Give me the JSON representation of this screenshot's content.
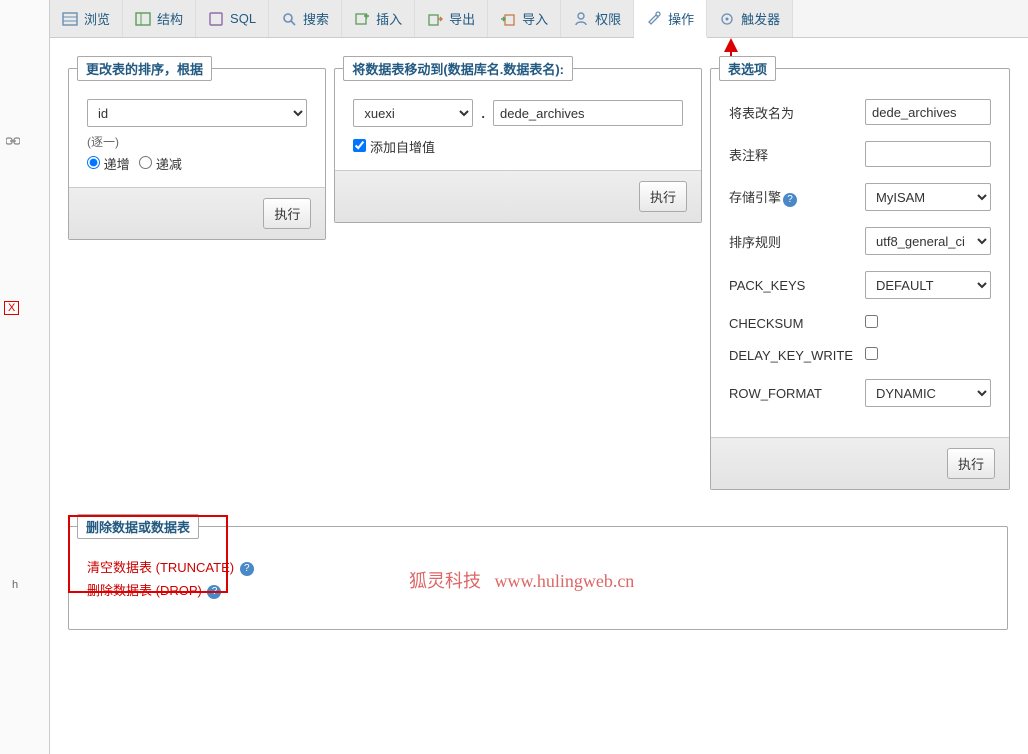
{
  "sidebar": {
    "badge": "X",
    "truncated": "h"
  },
  "nav": {
    "tabs": [
      {
        "label": "浏览",
        "icon_color": "#6b8fb5"
      },
      {
        "label": "结构",
        "icon_color": "#5a9e5a"
      },
      {
        "label": "SQL",
        "icon_color": "#8a6ca8"
      },
      {
        "label": "搜索",
        "icon_color": "#6b8fb5"
      },
      {
        "label": "插入",
        "icon_color": "#5a9e5a"
      },
      {
        "label": "导出",
        "icon_color": "#5a9e5a"
      },
      {
        "label": "导入",
        "icon_color": "#c77b4a"
      },
      {
        "label": "权限",
        "icon_color": "#6b8fb5"
      },
      {
        "label": "操作",
        "icon_color": "#6b8fb5"
      },
      {
        "label": "触发器",
        "icon_color": "#6b8fb5"
      }
    ],
    "active_index": 8
  },
  "panel_order": {
    "legend": "更改表的排序，根据",
    "column_select": "id",
    "hint": "(逐一)",
    "asc_label": "递增",
    "desc_label": "递减",
    "go_label": "执行"
  },
  "panel_move": {
    "legend": "将数据表移动到(数据库名.数据表名):",
    "db_select": "xuexi",
    "dot": ".",
    "table_input": "dede_archives",
    "add_auto_label": "添加自增值",
    "go_label": "执行"
  },
  "panel_options": {
    "legend": "表选项",
    "rows": {
      "rename": {
        "label": "将表改名为",
        "value": "dede_archives"
      },
      "comment": {
        "label": "表注释",
        "value": ""
      },
      "engine": {
        "label": "存储引擎",
        "value": "MyISAM"
      },
      "collation": {
        "label": "排序规则",
        "value": "utf8_general_ci"
      },
      "pack_keys": {
        "label": "PACK_KEYS",
        "value": "DEFAULT"
      },
      "checksum": {
        "label": "CHECKSUM"
      },
      "delay_key_write": {
        "label": "DELAY_KEY_WRITE"
      },
      "row_format": {
        "label": "ROW_FORMAT",
        "value": "DYNAMIC"
      }
    },
    "go_label": "执行"
  },
  "panel_delete": {
    "legend": "删除数据或数据表",
    "truncate_label": "清空数据表 (TRUNCATE)",
    "drop_label": "删除数据表 (DROP)"
  },
  "watermark": {
    "brand": "狐灵科技",
    "url": "www.hulingweb.cn"
  }
}
